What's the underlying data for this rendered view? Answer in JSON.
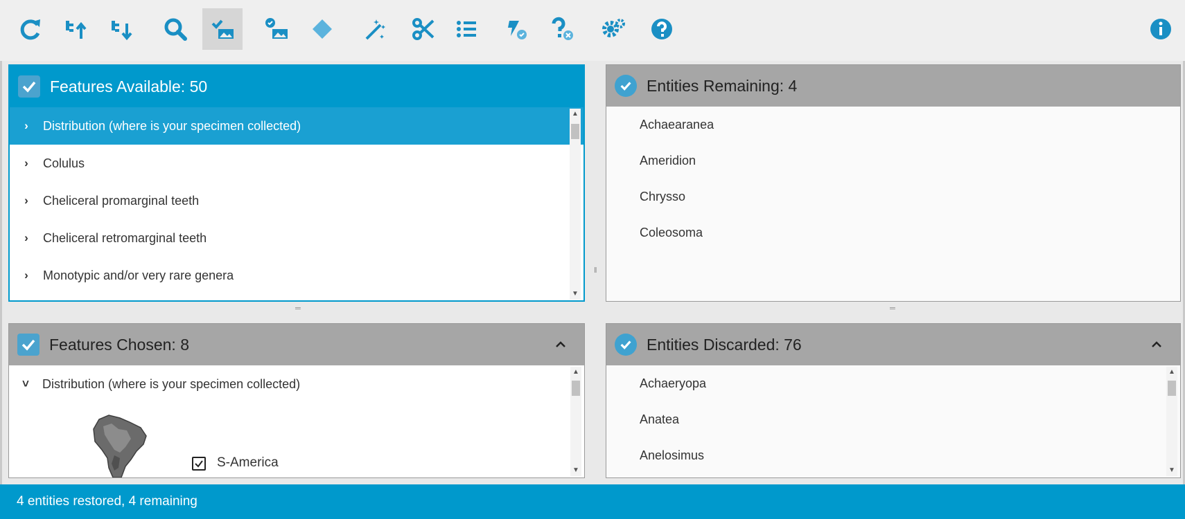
{
  "toolbar": {
    "buttons": [
      {
        "name": "refresh-icon",
        "tip": "Restart"
      },
      {
        "name": "sort-ascending-icon",
        "tip": "Best order"
      },
      {
        "name": "sort-descending-icon",
        "tip": "Natural order"
      },
      {
        "name": "search-icon",
        "tip": "Find"
      },
      {
        "name": "show-images-icon",
        "tip": "Images",
        "active": true
      },
      {
        "name": "image-settings-icon",
        "tip": "Image settings"
      },
      {
        "name": "diamond-icon",
        "tip": "Diagnostic"
      },
      {
        "name": "magic-wand-icon",
        "tip": "Auto"
      },
      {
        "name": "scissors-icon",
        "tip": "Separate"
      },
      {
        "name": "list-icon",
        "tip": "Differences"
      },
      {
        "name": "lightning-check-icon",
        "tip": "Set mode"
      },
      {
        "name": "question-x-icon",
        "tip": "Unknowns"
      },
      {
        "name": "settings-icon",
        "tip": "Settings"
      },
      {
        "name": "help-icon",
        "tip": "Help"
      }
    ],
    "info_icon": "info-icon"
  },
  "features_available": {
    "title": "Features Available: 50",
    "items": [
      "Distribution (where is your specimen collected)",
      "Colulus",
      "Cheliceral promarginal teeth",
      "Cheliceral retromarginal teeth",
      "Monotypic and/or very rare genera"
    ],
    "selected_index": 0
  },
  "entities_remaining": {
    "title": "Entities Remaining: 4",
    "items": [
      "Achaearanea",
      "Ameridion",
      "Chrysso",
      "Coleosoma"
    ]
  },
  "features_chosen": {
    "title": "Features Chosen: 8",
    "items": [
      "Distribution (where is your specimen collected)"
    ],
    "state_label": "S-America"
  },
  "entities_discarded": {
    "title": "Entities Discarded: 76",
    "items": [
      "Achaeryopa",
      "Anatea",
      "Anelosimus"
    ]
  },
  "status": {
    "text": "4 entities restored, 4 remaining"
  },
  "colors": {
    "accent": "#0099cc",
    "icon": "#1a8fc4",
    "header_inactive": "#a6a6a6"
  }
}
